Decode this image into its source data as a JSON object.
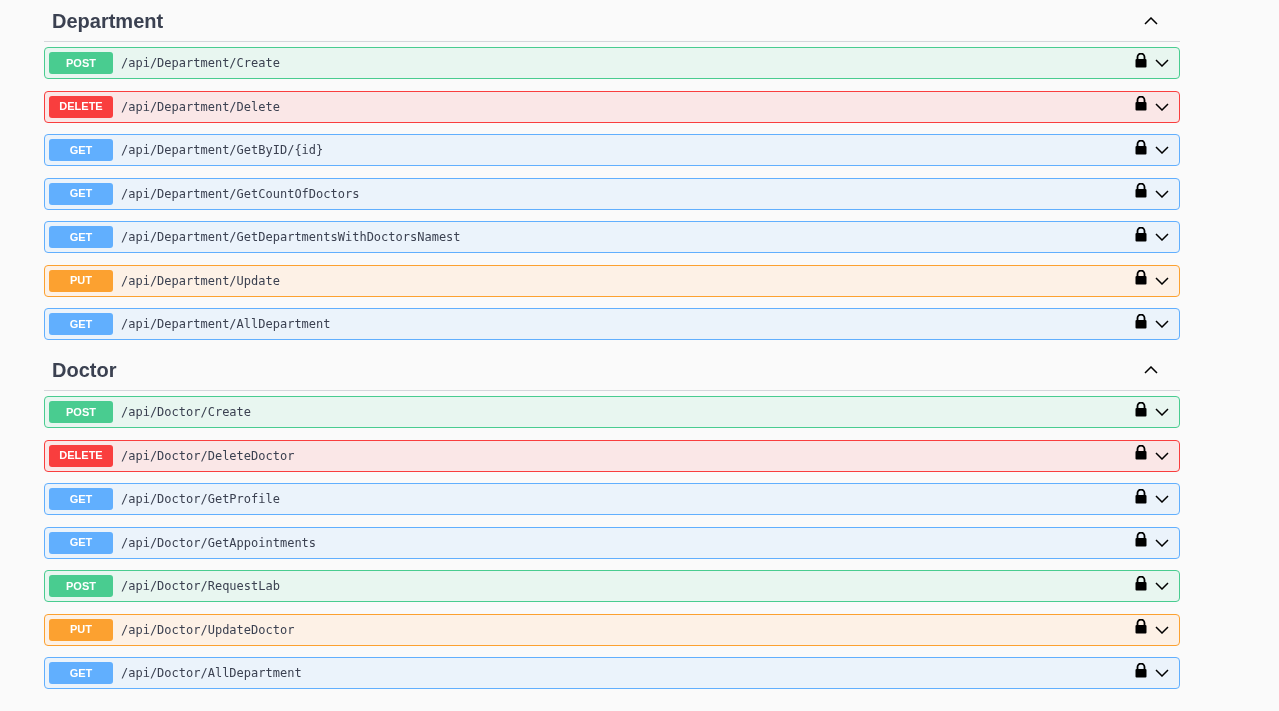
{
  "sections": [
    {
      "title": "Department",
      "expanded": true,
      "operations": [
        {
          "method": "POST",
          "path": "/api/Department/Create"
        },
        {
          "method": "DELETE",
          "path": "/api/Department/Delete"
        },
        {
          "method": "GET",
          "path": "/api/Department/GetByID/{id}"
        },
        {
          "method": "GET",
          "path": "/api/Department/GetCountOfDoctors"
        },
        {
          "method": "GET",
          "path": "/api/Department/GetDepartmentsWithDoctorsNamest"
        },
        {
          "method": "PUT",
          "path": "/api/Department/Update"
        },
        {
          "method": "GET",
          "path": "/api/Department/AllDepartment"
        }
      ]
    },
    {
      "title": "Doctor",
      "expanded": true,
      "operations": [
        {
          "method": "POST",
          "path": "/api/Doctor/Create"
        },
        {
          "method": "DELETE",
          "path": "/api/Doctor/DeleteDoctor"
        },
        {
          "method": "GET",
          "path": "/api/Doctor/GetProfile"
        },
        {
          "method": "GET",
          "path": "/api/Doctor/GetAppointments"
        },
        {
          "method": "POST",
          "path": "/api/Doctor/RequestLab"
        },
        {
          "method": "PUT",
          "path": "/api/Doctor/UpdateDoctor"
        },
        {
          "method": "GET",
          "path": "/api/Doctor/AllDepartment"
        }
      ]
    }
  ]
}
